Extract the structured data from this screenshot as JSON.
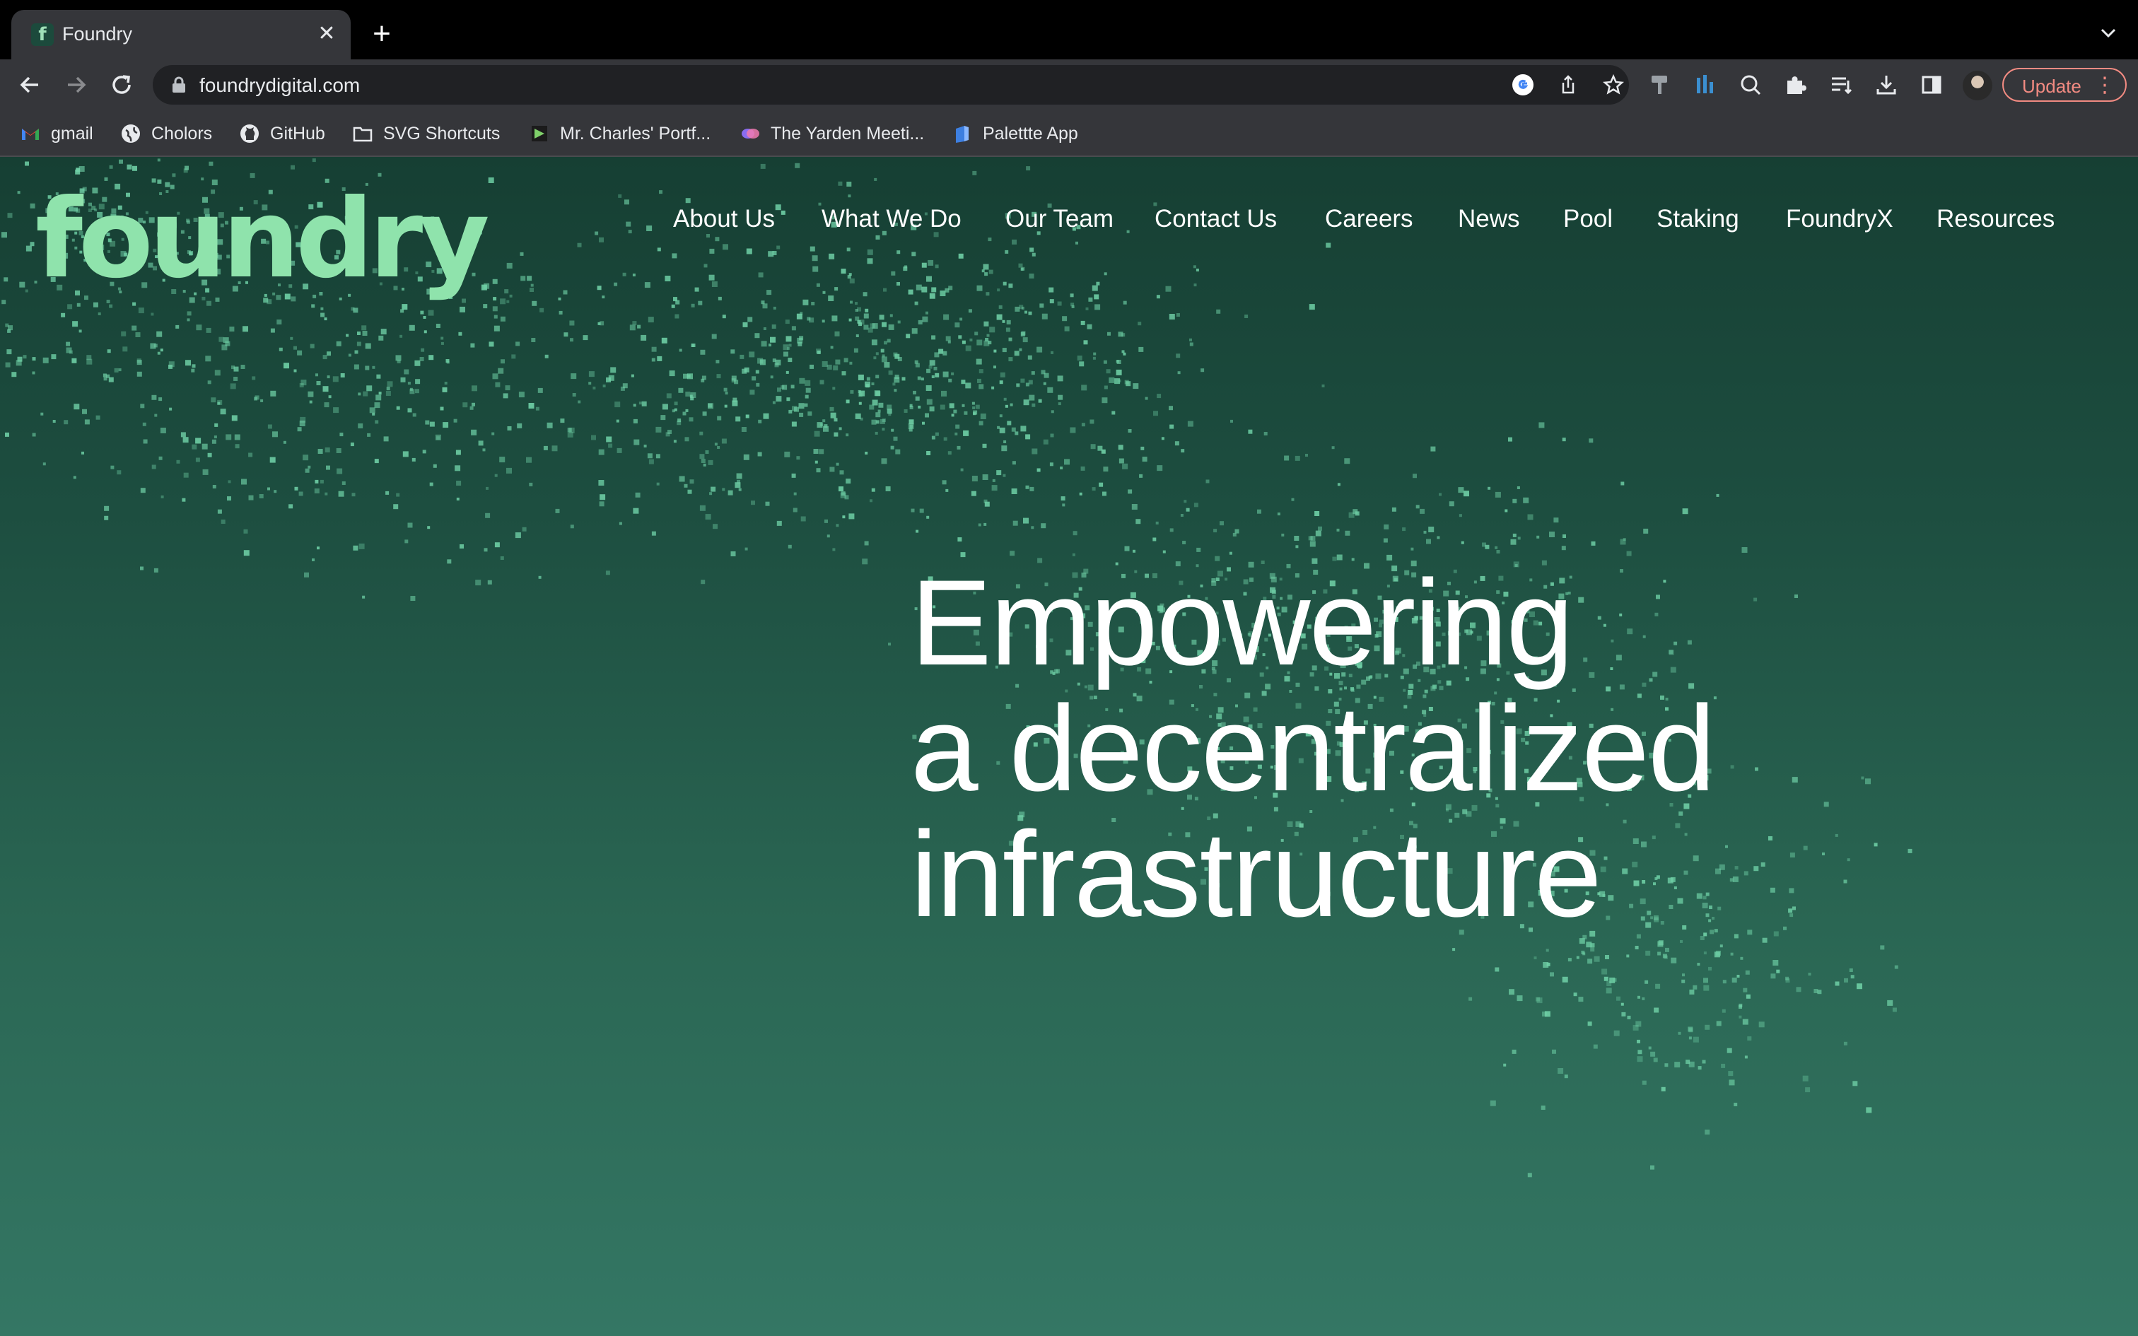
{
  "browser": {
    "tab": {
      "title": "Foundry",
      "favicon_letter": "f",
      "close_icon": "close-icon"
    },
    "new_tab_icon": "plus-icon",
    "toolbar": {
      "url": "foundrydigital.com",
      "update_label": "Update",
      "update_menu": "⋮"
    },
    "bookmarks": [
      {
        "label": "gmail",
        "icon": "gmail-icon"
      },
      {
        "label": "Cholors",
        "icon": "globe-icon"
      },
      {
        "label": "GitHub",
        "icon": "github-icon"
      },
      {
        "label": "SVG Shortcuts",
        "icon": "folder-icon"
      },
      {
        "label": "Mr. Charles' Portf...",
        "icon": "portfolio-icon"
      },
      {
        "label": "The Yarden Meeti...",
        "icon": "yarden-icon"
      },
      {
        "label": "Palettte App",
        "icon": "palette-icon"
      }
    ]
  },
  "site": {
    "logo": "foundry",
    "nav": [
      "About Us",
      "What We Do",
      "Our Team",
      "Contact Us",
      "Careers",
      "News",
      "Pool",
      "Staking",
      "FoundryX",
      "Resources"
    ],
    "hero": {
      "line1": "Empowering",
      "line2": "a decentralized",
      "line3": "infrastructure"
    }
  },
  "colors": {
    "brand_green": "#8fe3ac",
    "page_bg_top": "#163f33",
    "page_bg_bottom": "#347764",
    "particle": "#6fd0a6",
    "update_accent": "#f28b82"
  }
}
